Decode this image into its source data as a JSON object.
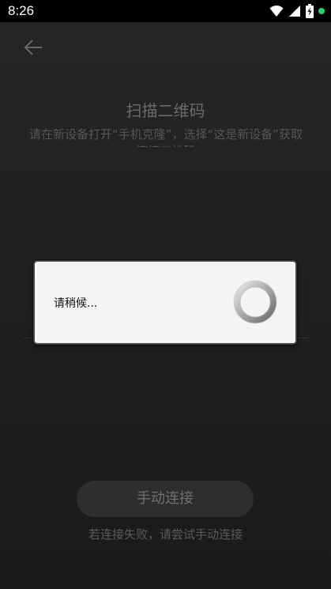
{
  "status_bar": {
    "time": "8:26",
    "icons": [
      "wifi-icon",
      "signal-icon",
      "battery-charging-icon",
      "notification-dot-icon"
    ],
    "accent_dot_color": "#2ecc71"
  },
  "page": {
    "back_icon": "arrow-left-icon",
    "title": "扫描二维码",
    "subtitle": "请在新设备打开“手机克隆”，选择“这是新设备”获取连接二维码",
    "manual_connect_label": "手动连接",
    "hint": "若连接失败，请尝试手动连接"
  },
  "dialog": {
    "message": "请稍候...",
    "spinner_icon": "loading-spinner-icon"
  }
}
